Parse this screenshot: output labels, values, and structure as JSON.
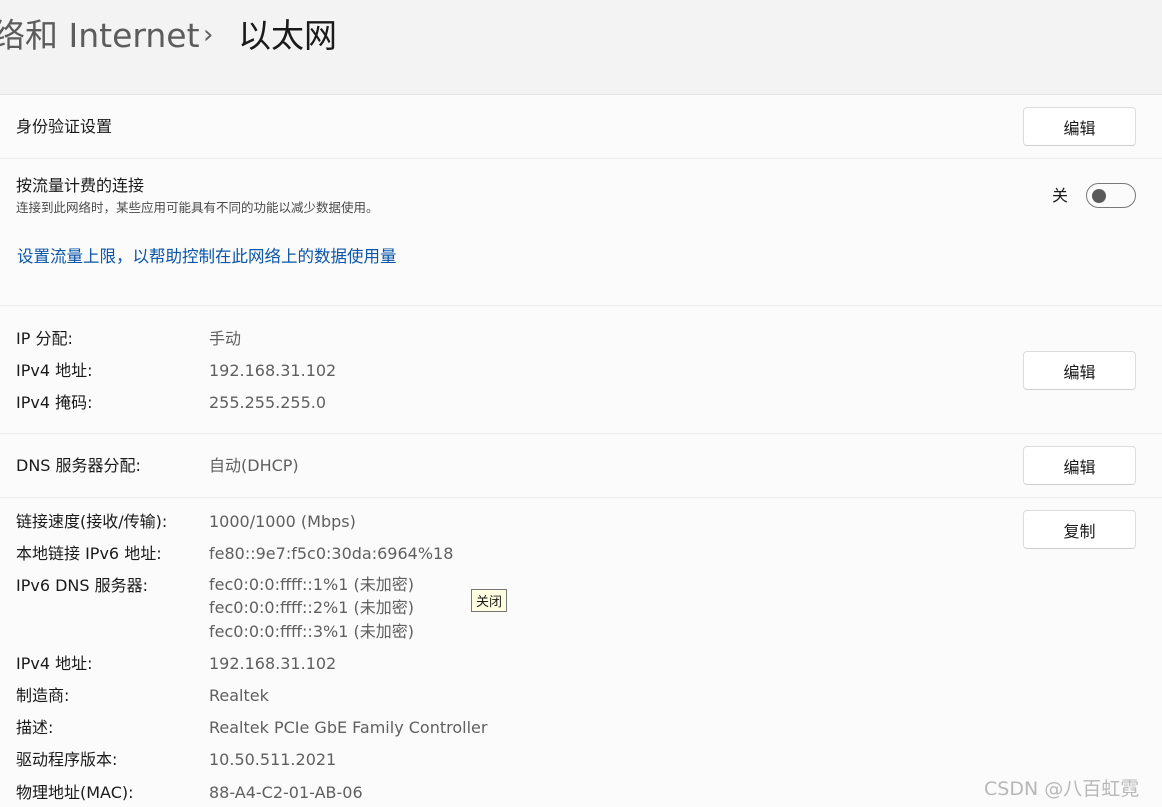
{
  "breadcrumb": {
    "parent": "络和 Internet",
    "separator": "›",
    "current": "以太网"
  },
  "auth": {
    "label": "身份验证设置",
    "button": "编辑"
  },
  "metered": {
    "title": "按流量计费的连接",
    "description": "连接到此网络时，某些应用可能具有不同的功能以减少数据使用。",
    "state_label": "关",
    "enabled": false,
    "link": "设置流量上限，以帮助控制在此网络上的数据使用量"
  },
  "ip": {
    "rows": [
      {
        "label": "IP 分配:",
        "value": "手动"
      },
      {
        "label": "IPv4 地址:",
        "value": "192.168.31.102"
      },
      {
        "label": "IPv4 掩码:",
        "value": "255.255.255.0"
      }
    ],
    "button": "编辑"
  },
  "dns": {
    "label": "DNS 服务器分配:",
    "value": "自动(DHCP)",
    "button": "编辑"
  },
  "properties": {
    "button": "复制",
    "link_speed": {
      "label": "链接速度(接收/传输):",
      "value": "1000/1000 (Mbps)"
    },
    "ipv6_link_local": {
      "label": "本地链接 IPv6 地址:",
      "value": "fe80::9e7:f5c0:30da:6964%18"
    },
    "ipv6_dns": {
      "label": "IPv6 DNS 服务器:",
      "values": [
        "fec0:0:0:ffff::1%1 (未加密)",
        "fec0:0:0:ffff::2%1 (未加密)",
        "fec0:0:0:ffff::3%1 (未加密)"
      ]
    },
    "ipv4": {
      "label": "IPv4 地址:",
      "value": "192.168.31.102"
    },
    "manufacturer": {
      "label": "制造商:",
      "value": "Realtek"
    },
    "description": {
      "label": "描述:",
      "value": "Realtek PCIe GbE Family Controller"
    },
    "driver": {
      "label": "驱动程序版本:",
      "value": "10.50.511.2021"
    },
    "mac": {
      "label": "物理地址(MAC):",
      "value": "88-A4-C2-01-AB-06"
    }
  },
  "tooltip": "关闭",
  "watermark": "CSDN @八百虹霓"
}
